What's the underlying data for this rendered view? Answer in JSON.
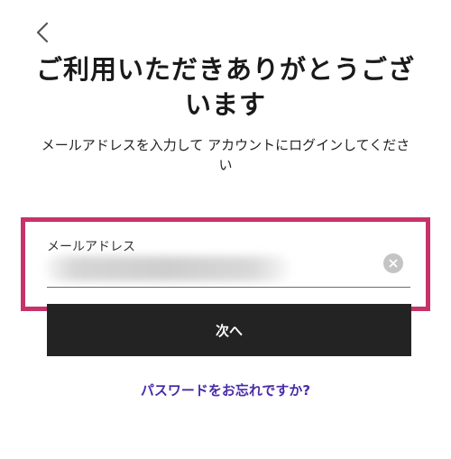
{
  "header": {
    "back_icon": "chevron-left-icon",
    "title": "ご利用いただきありがとうございます",
    "subtitle": "メールアドレスを入力して アカウントにログインしてください"
  },
  "form": {
    "email_label": "メールアドレス",
    "email_value_hidden": true,
    "clear_icon": "clear-circle-icon",
    "next_button_label": "次へ"
  },
  "links": {
    "forgot_password": "パスワードをお忘れですか?"
  },
  "colors": {
    "highlight_border": "#c5336a",
    "button_bg": "#232323",
    "link": "#4a2ca8"
  }
}
